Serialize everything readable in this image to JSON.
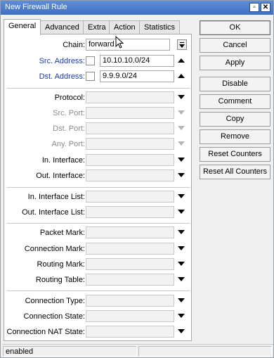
{
  "window": {
    "title": "New Firewall Rule"
  },
  "tabs": [
    {
      "label": "General"
    },
    {
      "label": "Advanced"
    },
    {
      "label": "Extra"
    },
    {
      "label": "Action"
    },
    {
      "label": "Statistics"
    }
  ],
  "active_tab": "General",
  "general": {
    "chain": {
      "label": "Chain:",
      "value": "forward"
    },
    "src_address": {
      "label": "Src. Address:",
      "value": "10.10.10.0/24"
    },
    "dst_address": {
      "label": "Dst. Address:",
      "value": "9.9.9.0/24"
    },
    "protocol": {
      "label": "Protocol:",
      "value": ""
    },
    "src_port": {
      "label": "Src. Port:",
      "value": ""
    },
    "dst_port": {
      "label": "Dst. Port:",
      "value": ""
    },
    "any_port": {
      "label": "Any. Port:",
      "value": ""
    },
    "in_interface": {
      "label": "In. Interface:",
      "value": ""
    },
    "out_interface": {
      "label": "Out. Interface:",
      "value": ""
    },
    "in_interface_list": {
      "label": "In. Interface List:",
      "value": ""
    },
    "out_interface_list": {
      "label": "Out. Interface List:",
      "value": ""
    },
    "packet_mark": {
      "label": "Packet Mark:",
      "value": ""
    },
    "connection_mark": {
      "label": "Connection Mark:",
      "value": ""
    },
    "routing_mark": {
      "label": "Routing Mark:",
      "value": ""
    },
    "routing_table": {
      "label": "Routing Table:",
      "value": ""
    },
    "connection_type": {
      "label": "Connection Type:",
      "value": ""
    },
    "connection_state": {
      "label": "Connection State:",
      "value": ""
    },
    "connection_nat_state": {
      "label": "Connection NAT State:",
      "value": ""
    }
  },
  "buttons": {
    "ok": "OK",
    "cancel": "Cancel",
    "apply": "Apply",
    "disable": "Disable",
    "comment": "Comment",
    "copy": "Copy",
    "remove": "Remove",
    "reset_counters": "Reset Counters",
    "reset_all_counters": "Reset All Counters"
  },
  "status": {
    "state": "enabled",
    "extra": ""
  },
  "colors": {
    "titlebar": "#4a7bcc",
    "field_label_address": "#1a39b5",
    "disabled_label": "#8a8a8a"
  }
}
